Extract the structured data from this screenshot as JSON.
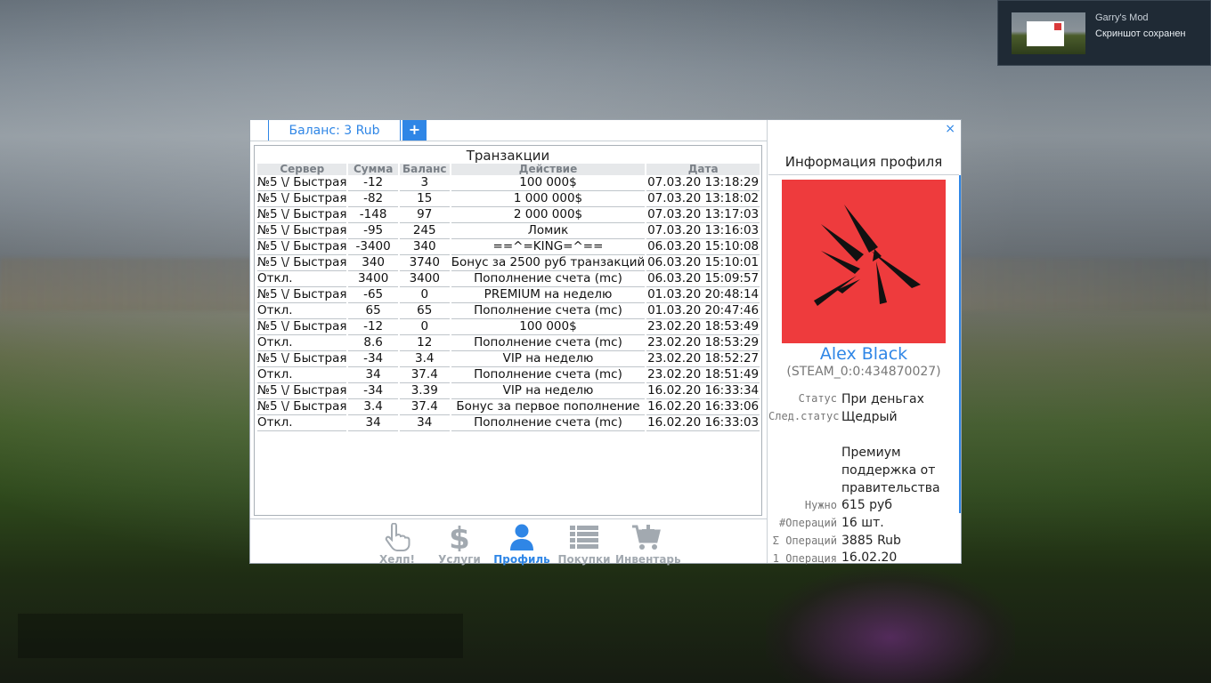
{
  "notification": {
    "app": "Garry's Mod",
    "message": "Скриншот сохранен"
  },
  "window": {
    "balance_tab": "Баланс: 3 Rub",
    "add_tab": "+",
    "close": "×"
  },
  "transactions": {
    "title": "Транзакции",
    "columns": [
      "Сервер",
      "Сумма",
      "Баланс",
      "Действие",
      "Дата"
    ],
    "rows": [
      [
        "№5 \\/ Быстрая",
        "-12",
        "3",
        "100 000$",
        "07.03.20 13:18:29"
      ],
      [
        "№5 \\/ Быстрая",
        "-82",
        "15",
        "1 000 000$",
        "07.03.20 13:18:02"
      ],
      [
        "№5 \\/ Быстрая",
        "-148",
        "97",
        "2 000 000$",
        "07.03.20 13:17:03"
      ],
      [
        "№5 \\/ Быстрая",
        "-95",
        "245",
        "Ломик",
        "07.03.20 13:16:03"
      ],
      [
        "№5 \\/ Быстрая",
        "-3400",
        "340",
        "==^=KING=^==",
        "06.03.20 15:10:08"
      ],
      [
        "№5 \\/ Быстрая",
        "340",
        "3740",
        "Бонус за 2500 руб транзакций",
        "06.03.20 15:10:01"
      ],
      [
        "Откл.",
        "3400",
        "3400",
        "Пополнение счета (mc)",
        "06.03.20 15:09:57"
      ],
      [
        "№5 \\/ Быстрая",
        "-65",
        "0",
        "PREMIUM на неделю",
        "01.03.20 20:48:14"
      ],
      [
        "Откл.",
        "65",
        "65",
        "Пополнение счета (mc)",
        "01.03.20 20:47:46"
      ],
      [
        "№5 \\/ Быстрая",
        "-12",
        "0",
        "100 000$",
        "23.02.20 18:53:49"
      ],
      [
        "Откл.",
        "8.6",
        "12",
        "Пополнение счета (mc)",
        "23.02.20 18:53:29"
      ],
      [
        "№5 \\/ Быстрая",
        "-34",
        "3.4",
        "VIP на неделю",
        "23.02.20 18:52:27"
      ],
      [
        "Откл.",
        "34",
        "37.4",
        "Пополнение счета (mc)",
        "23.02.20 18:51:49"
      ],
      [
        "№5 \\/ Быстрая",
        "-34",
        "3.39",
        "VIP на неделю",
        "16.02.20 16:33:34"
      ],
      [
        "№5 \\/ Быстрая",
        "3.4",
        "37.4",
        "Бонус за первое пополнение",
        "16.02.20 16:33:06"
      ],
      [
        "Откл.",
        "34",
        "34",
        "Пополнение счета (mc)",
        "16.02.20 16:33:03"
      ]
    ]
  },
  "nav": {
    "items": [
      {
        "label": "Хелп!",
        "icon": "hand-pointer-icon",
        "active": false
      },
      {
        "label": "Услуги",
        "icon": "dollar-icon",
        "active": false
      },
      {
        "label": "Профиль",
        "icon": "user-icon",
        "active": true
      },
      {
        "label": "Покупки",
        "icon": "list-icon",
        "active": false
      },
      {
        "label": "Инвентарь",
        "icon": "cart-plus-icon",
        "active": false
      }
    ]
  },
  "profile": {
    "title": "Информация профиля",
    "name": "Alex Black",
    "steam_id": "(STEAM_0:0:434870027)",
    "status_label": "Статус",
    "status_value": "При деньгах",
    "next_status_label": "След.статус",
    "next_status_value": "Щедрый",
    "next_status_desc": "Премиум поддержка от правительства",
    "need_label": "Нужно",
    "need_value": "615 руб",
    "ops_count_label": "#Операций",
    "ops_count_value": "16 шт.",
    "ops_sum_label": "Σ Операций",
    "ops_sum_value": "3885 Rub",
    "first_op_label": "1 Операция",
    "first_op_value": "16.02.20"
  },
  "colors": {
    "accent": "#2f86e6",
    "avatar_bg": "#ee3b3d",
    "muted": "#a2a9b0"
  }
}
